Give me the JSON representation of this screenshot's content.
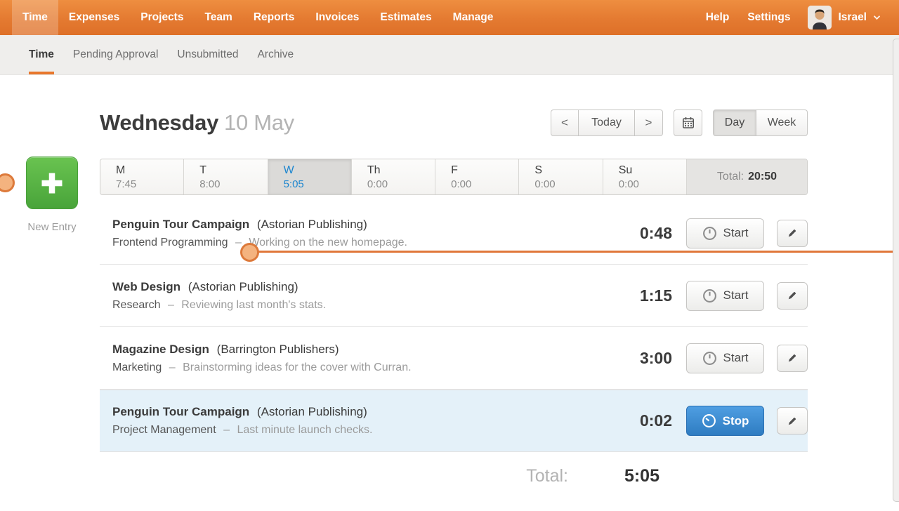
{
  "nav": {
    "items": [
      "Time",
      "Expenses",
      "Projects",
      "Team",
      "Reports",
      "Invoices",
      "Estimates",
      "Manage"
    ],
    "help": "Help",
    "settings": "Settings",
    "user_name": "Israel"
  },
  "tabs": [
    "Time",
    "Pending Approval",
    "Unsubmitted",
    "Archive"
  ],
  "header": {
    "day_name": "Wednesday",
    "date": "10 May",
    "prev": "<",
    "today": "Today",
    "next": ">",
    "day_toggle": "Day",
    "week_toggle": "Week"
  },
  "week": {
    "days": [
      {
        "label": "M",
        "time": "7:45"
      },
      {
        "label": "T",
        "time": "8:00"
      },
      {
        "label": "W",
        "time": "5:05"
      },
      {
        "label": "Th",
        "time": "0:00"
      },
      {
        "label": "F",
        "time": "0:00"
      },
      {
        "label": "S",
        "time": "0:00"
      },
      {
        "label": "Su",
        "time": "0:00"
      }
    ],
    "total_label": "Total:",
    "total_value": "20:50"
  },
  "new_entry_label": "New Entry",
  "entries": [
    {
      "project": "Penguin Tour Campaign",
      "client": "(Astorian Publishing)",
      "task": "Frontend Programming",
      "separator": "–",
      "notes": "Working on the new homepage.",
      "duration": "0:48",
      "action": "Start"
    },
    {
      "project": "Web Design",
      "client": "(Astorian Publishing)",
      "task": "Research",
      "separator": "–",
      "notes": "Reviewing last month's stats.",
      "duration": "1:15",
      "action": "Start"
    },
    {
      "project": "Magazine Design",
      "client": "(Barrington Publishers)",
      "task": "Marketing",
      "separator": "–",
      "notes": "Brainstorming ideas for the cover with Curran.",
      "duration": "3:00",
      "action": "Start"
    },
    {
      "project": "Penguin Tour Campaign",
      "client": "(Astorian Publishing)",
      "task": "Project Management",
      "separator": "–",
      "notes": "Last minute launch checks.",
      "duration": "0:02",
      "action": "Stop"
    }
  ],
  "day_total": {
    "label": "Total:",
    "value": "5:05"
  },
  "colors": {
    "brand_orange": "#e8772c",
    "accent_blue": "#2e7cc1",
    "green": "#54ae43",
    "active_row_bg": "#e4f1f9",
    "annotation_orange": "#dd7a3b"
  }
}
